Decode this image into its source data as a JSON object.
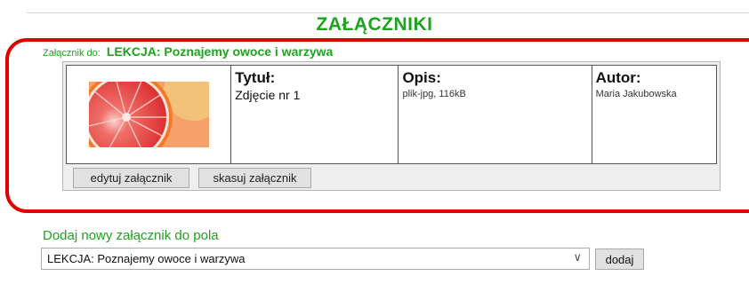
{
  "page": {
    "title": "ZAŁĄCZNIKI"
  },
  "attachment_for": {
    "label": "Załącznik do:",
    "lesson": "LEKCJA: Poznajemy owoce i warzywa"
  },
  "attachment": {
    "image_icon": "grapefruit-photo",
    "title_header": "Tytuł:",
    "title_value": "Zdjęcie nr 1",
    "description_header": "Opis:",
    "description_value": "plik-jpg, 116kB",
    "author_header": "Autor:",
    "author_value": "Maria Jakubowska",
    "edit_label": "edytuj załącznik",
    "delete_label": "skasuj załącznik"
  },
  "add_section": {
    "label": "Dodaj nowy załącznik do pola",
    "selected_option": "LEKCJA: Poznajemy owoce i warzywa",
    "add_button_label": "dodaj"
  },
  "colors": {
    "accent_green": "#1ea31e",
    "highlight_red": "#e00000"
  }
}
